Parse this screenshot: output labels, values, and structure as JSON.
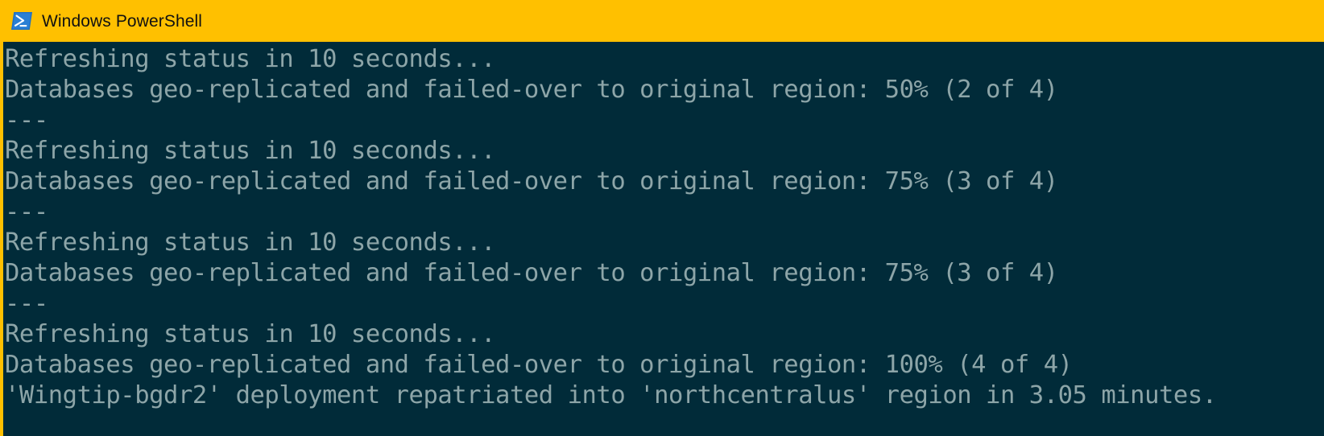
{
  "window": {
    "title": "Windows PowerShell",
    "icon": "powershell-icon",
    "titlebar_color": "#ffc000",
    "terminal_bg_color": "#012b39",
    "terminal_text_color": "#8da5a8"
  },
  "terminal": {
    "lines": [
      "Refreshing status in 10 seconds...",
      "Databases geo-replicated and failed-over to original region: 50% (2 of 4)",
      "---",
      "Refreshing status in 10 seconds...",
      "Databases geo-replicated and failed-over to original region: 75% (3 of 4)",
      "---",
      "Refreshing status in 10 seconds...",
      "Databases geo-replicated and failed-over to original region: 75% (3 of 4)",
      "---",
      "Refreshing status in 10 seconds...",
      "Databases geo-replicated and failed-over to original region: 100% (4 of 4)",
      "'Wingtip-bgdr2' deployment repatriated into 'northcentralus' region in 3.05 minutes."
    ],
    "progress": {
      "label": "Databases geo-replicated and failed-over to original region",
      "values": [
        "50% (2 of 4)",
        "75% (3 of 4)",
        "75% (3 of 4)",
        "100% (4 of 4)"
      ]
    },
    "summary": {
      "deployment_name": "Wingtip-bgdr2",
      "region": "northcentralus",
      "elapsed": "3.05 minutes"
    }
  }
}
